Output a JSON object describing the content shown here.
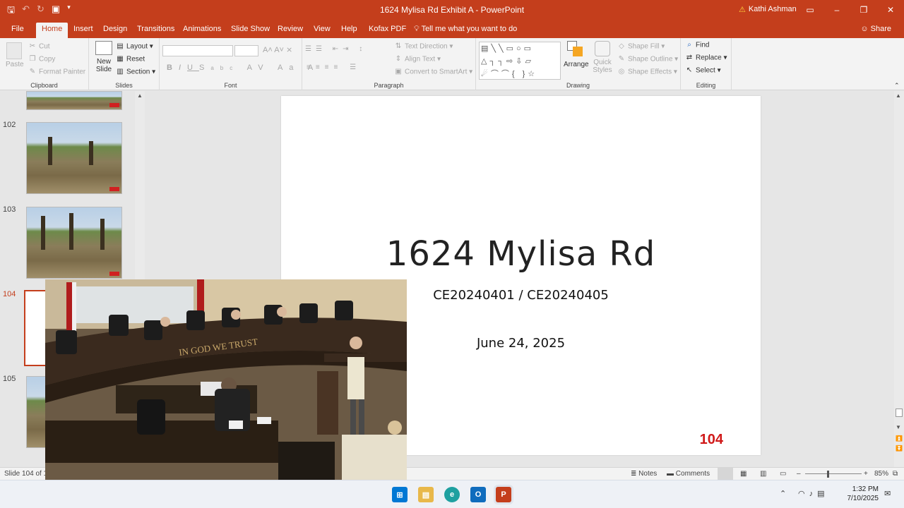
{
  "window": {
    "title": "1624 Mylisa Rd Exhibit A  -  PowerPoint",
    "user": "Kathi Ashman",
    "accent": "#c43e1c"
  },
  "tabs": [
    "File",
    "Home",
    "Insert",
    "Design",
    "Transitions",
    "Animations",
    "Slide Show",
    "Review",
    "View",
    "Help",
    "Kofax PDF"
  ],
  "tell_me": "Tell me what you want to do",
  "share_label": "Share",
  "ribbon": {
    "clipboard": {
      "label": "Clipboard",
      "paste": "Paste",
      "cut": "Cut",
      "copy": "Copy",
      "format_painter": "Format Painter"
    },
    "slides": {
      "label": "Slides",
      "new_slide": "New",
      "new_slide_2": "Slide",
      "layout": "Layout",
      "reset": "Reset",
      "section": "Section"
    },
    "font": {
      "label": "Font"
    },
    "paragraph": {
      "label": "Paragraph",
      "text_direction": "Text Direction",
      "align_text": "Align Text",
      "convert_smartart": "Convert to SmartArt"
    },
    "drawing": {
      "label": "Drawing",
      "arrange": "Arrange",
      "quick_styles": "Quick",
      "quick_styles_2": "Styles",
      "shape_fill": "Shape Fill",
      "shape_outline": "Shape Outline",
      "shape_effects": "Shape Effects"
    },
    "editing": {
      "label": "Editing",
      "find": "Find",
      "replace": "Replace",
      "select": "Select"
    }
  },
  "thumbnails": [
    {
      "number": "102"
    },
    {
      "number": "103"
    },
    {
      "number": "104"
    },
    {
      "number": "105"
    }
  ],
  "slide": {
    "title": "1624 Mylisa Rd",
    "case": "CE20240401 / CE20240405",
    "date": "June 24, 2025",
    "number": "104",
    "number_color": "#d01919"
  },
  "video_overlay": {
    "wall_text": "IN GOD WE TRUST"
  },
  "status": {
    "slide_indicator": "Slide 104 of 10",
    "notes": "Notes",
    "comments": "Comments",
    "zoom": "85%"
  },
  "taskbar": {
    "time": "1:32 PM",
    "date": "7/10/2025"
  }
}
